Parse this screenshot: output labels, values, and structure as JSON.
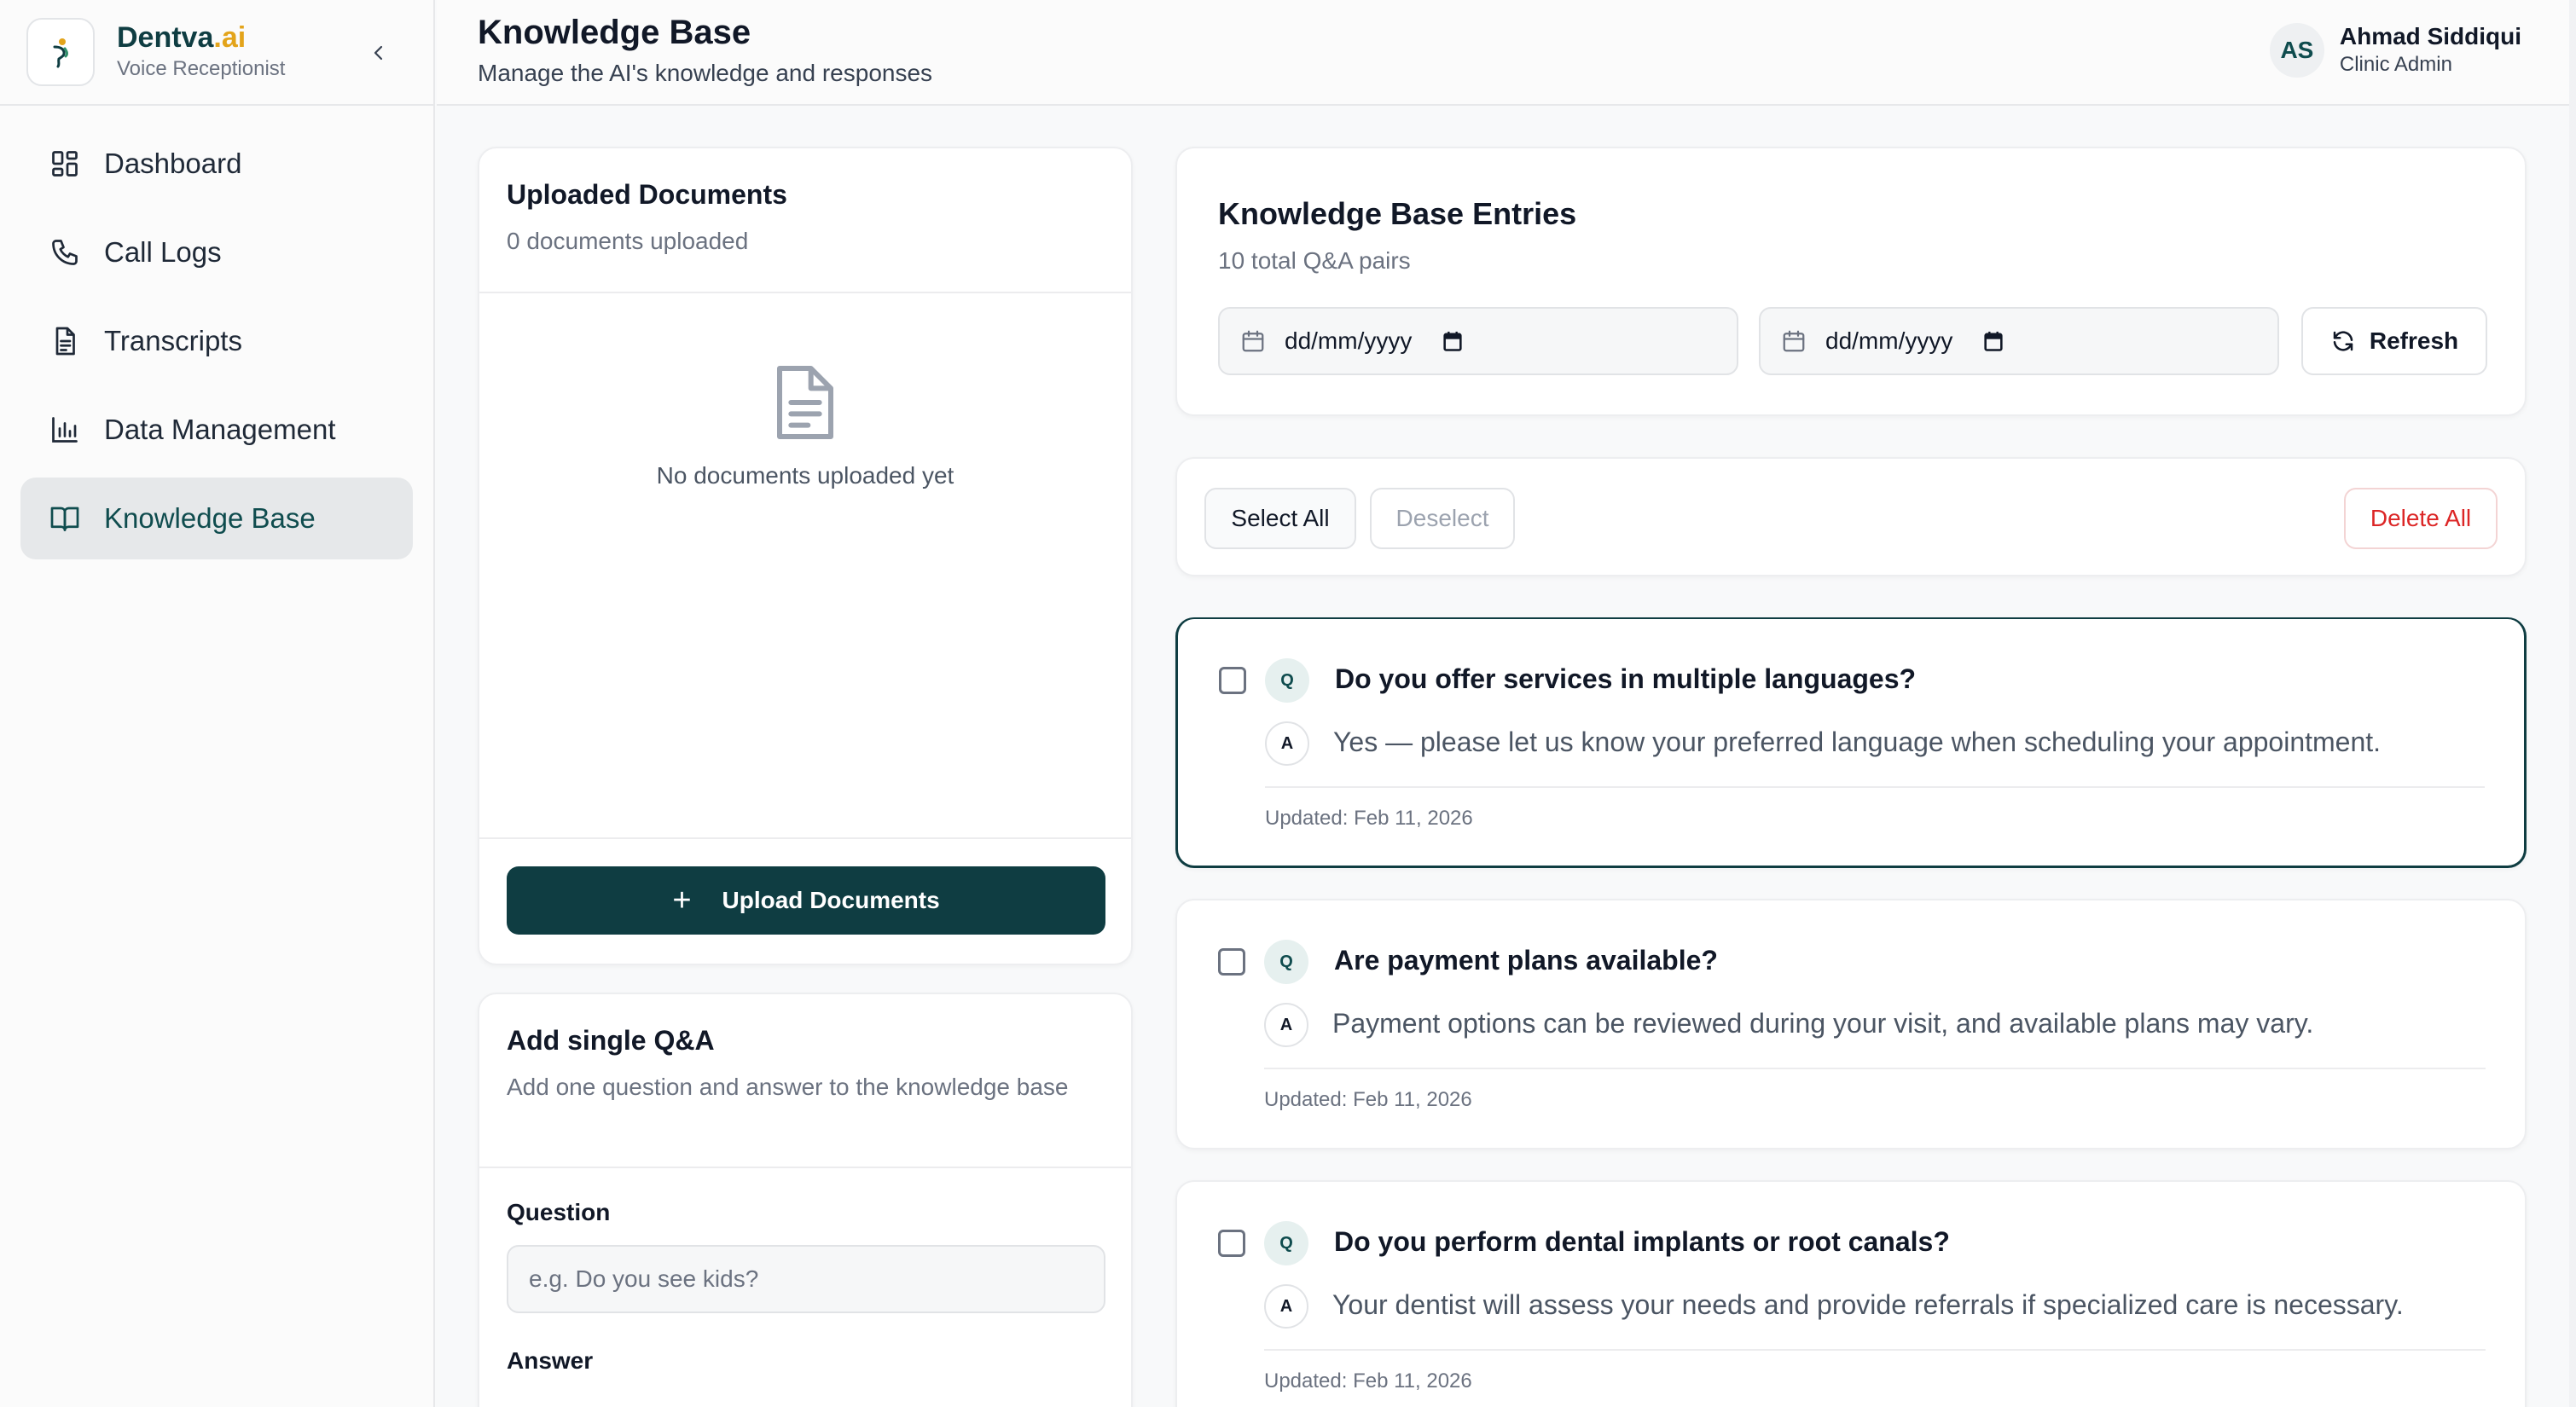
{
  "brand": {
    "name": "Dentva",
    "name_suffix": ".ai",
    "subtitle": "Voice Receptionist"
  },
  "sidebar": {
    "items": [
      {
        "label": "Dashboard",
        "icon": "dashboard-icon",
        "active": false
      },
      {
        "label": "Call Logs",
        "icon": "phone-icon",
        "active": false
      },
      {
        "label": "Transcripts",
        "icon": "document-icon",
        "active": false
      },
      {
        "label": "Data Management",
        "icon": "bar-chart-icon",
        "active": false
      },
      {
        "label": "Knowledge Base",
        "icon": "book-icon",
        "active": true
      }
    ]
  },
  "header": {
    "title": "Knowledge Base",
    "subtitle": "Manage the AI's knowledge and responses"
  },
  "user": {
    "initials": "AS",
    "name": "Ahmad Siddiqui",
    "role": "Clinic Admin"
  },
  "documents": {
    "title": "Uploaded Documents",
    "count_text": "0 documents uploaded",
    "empty_text": "No documents uploaded yet",
    "upload_label": "Upload Documents"
  },
  "single_qa": {
    "title": "Add single Q&A",
    "subtitle": "Add one question and answer to the knowledge base",
    "question_label": "Question",
    "question_placeholder": "e.g. Do you see kids?",
    "answer_label": "Answer"
  },
  "entries": {
    "title": "Knowledge Base Entries",
    "count_text": "10 total Q&A pairs",
    "date_from": "dd/mm/yyyy",
    "date_to": "dd/mm/yyyy",
    "refresh_label": "Refresh",
    "select_all_label": "Select All",
    "deselect_label": "Deselect",
    "delete_all_label": "Delete All",
    "q_badge": "Q",
    "a_badge": "A",
    "items": [
      {
        "question": "Do you offer services in multiple languages?",
        "answer": "Yes — please let us know your preferred language when scheduling your appointment.",
        "updated": "Updated: Feb 11, 2026",
        "checked": false
      },
      {
        "question": "Are payment plans available?",
        "answer": "Payment options can be reviewed during your visit, and available plans may vary.",
        "updated": "Updated: Feb 11, 2026",
        "checked": false
      },
      {
        "question": "Do you perform dental implants or root canals?",
        "answer": "Your dentist will assess your needs and provide referrals if specialized care is necessary.",
        "updated": "Updated: Feb 11, 2026",
        "checked": false
      }
    ]
  },
  "colors": {
    "brand_dark": "#0f3d42",
    "brand_accent": "#e3a41b",
    "danger": "#dc2626",
    "active_nav_bg": "#e6e8ea"
  }
}
